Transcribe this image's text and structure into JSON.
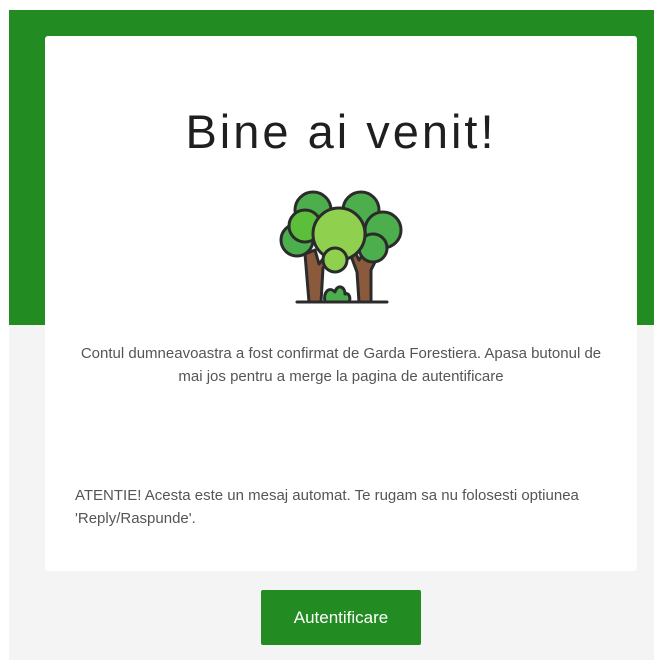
{
  "email": {
    "title": "Bine ai venit!",
    "illustration_icon": "trees-icon",
    "message": "Contul dumneavoastra a fost confirmat de Garda Forestiera. Apasa butonul de mai jos pentru a merge la pagina de autentificare",
    "warning": "ATENTIE! Acesta este un mesaj automat. Te rugam sa nu folosesti optiunea 'Reply/Raspunde'.",
    "button_label": "Autentificare"
  },
  "colors": {
    "brand_green": "#228b22",
    "background": "#f4f4f4",
    "card": "#ffffff",
    "text": "#555555",
    "title_text": "#1f1f1f"
  }
}
